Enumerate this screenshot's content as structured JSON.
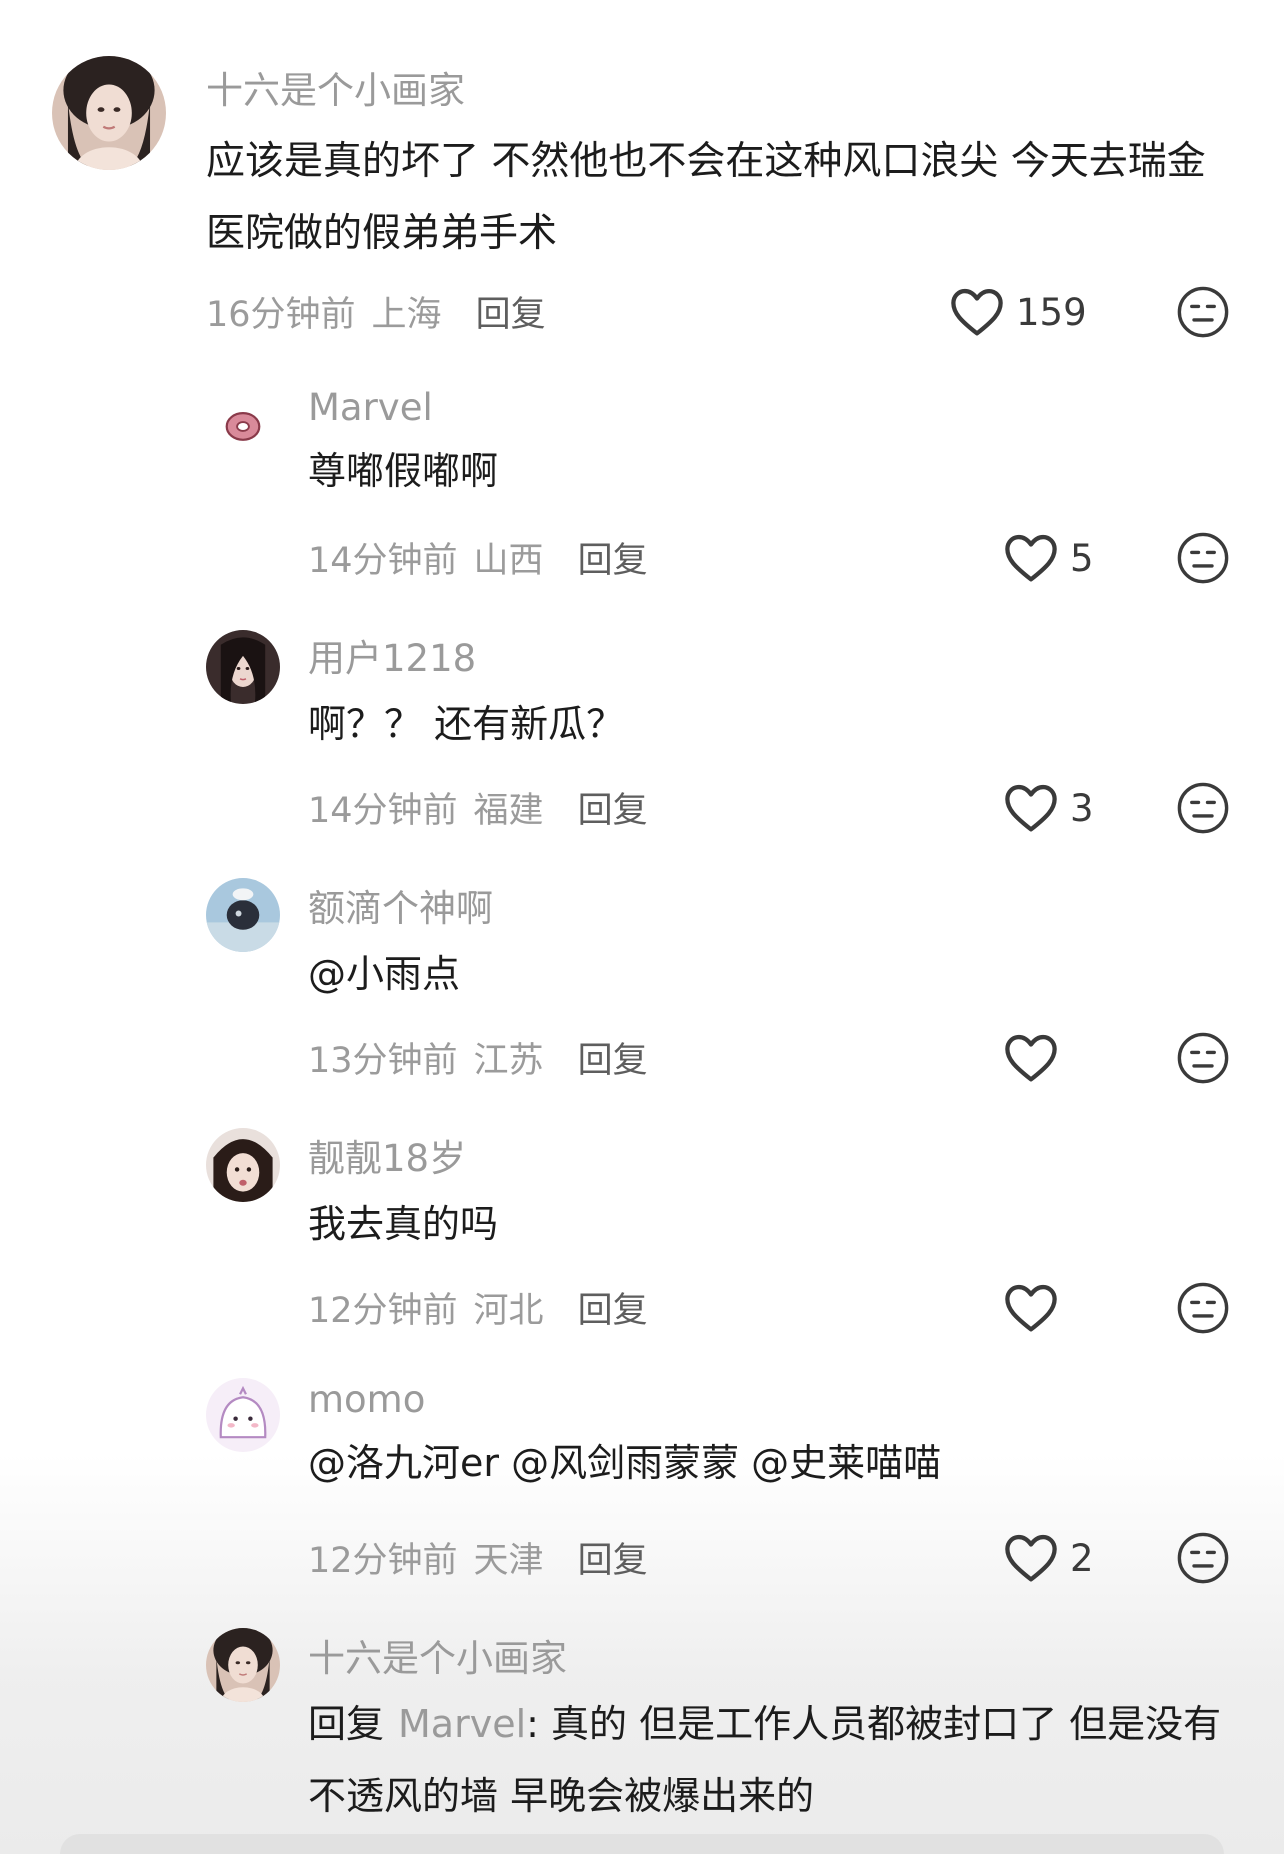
{
  "comments": [
    {
      "username": "十六是个小画家",
      "text": "应该是真的坏了 不然他也不会在这种风口浪尖 今天去瑞金医院做的假弟弟手术",
      "time": "16分钟前",
      "location": "上海",
      "reply_label": "回复",
      "likes": "159",
      "avatar": "female-photo"
    }
  ],
  "replies": [
    {
      "username": "Marvel",
      "text": "尊嘟假嘟啊",
      "time": "14分钟前",
      "location": "山西",
      "reply_label": "回复",
      "likes": "5",
      "avatar": "pink-donut"
    },
    {
      "username": "用户1218",
      "text": "啊？？ 还有新瓜？",
      "time": "14分钟前",
      "location": "福建",
      "reply_label": "回复",
      "likes": "3",
      "avatar": "female-photo-dark"
    },
    {
      "username": "额滴个神啊",
      "text": "@小雨点",
      "time": "13分钟前",
      "location": "江苏",
      "reply_label": "回复",
      "likes": "",
      "avatar": "sky-bird"
    },
    {
      "username": "靓靓18岁",
      "text": "我去真的吗",
      "time": "12分钟前",
      "location": "河北",
      "reply_label": "回复",
      "likes": "",
      "avatar": "female-selfie"
    },
    {
      "username": "momo",
      "text": "@洛九河er @风剑雨蒙蒙 @史莱喵喵",
      "time": "12分钟前",
      "location": "天津",
      "reply_label": "回复",
      "likes": "2",
      "avatar": "cartoon-ghost"
    },
    {
      "username": "十六是个小画家",
      "reply_prefix": "回复",
      "reply_target": "Marvel",
      "reply_suffix": ": 真的 但是工作人员都被封口了 但是没有不透风的墙 早晚会被爆出来的",
      "avatar": "female-photo"
    }
  ],
  "icons": {
    "like": "heart-outline-icon",
    "dislike": "neutral-face-icon"
  },
  "colors": {
    "username": "#9a9a9a",
    "text": "#1c1c1c",
    "meta": "#9b9b9b",
    "reply": "#5e5e5e",
    "icon": "#3a3a3a"
  }
}
